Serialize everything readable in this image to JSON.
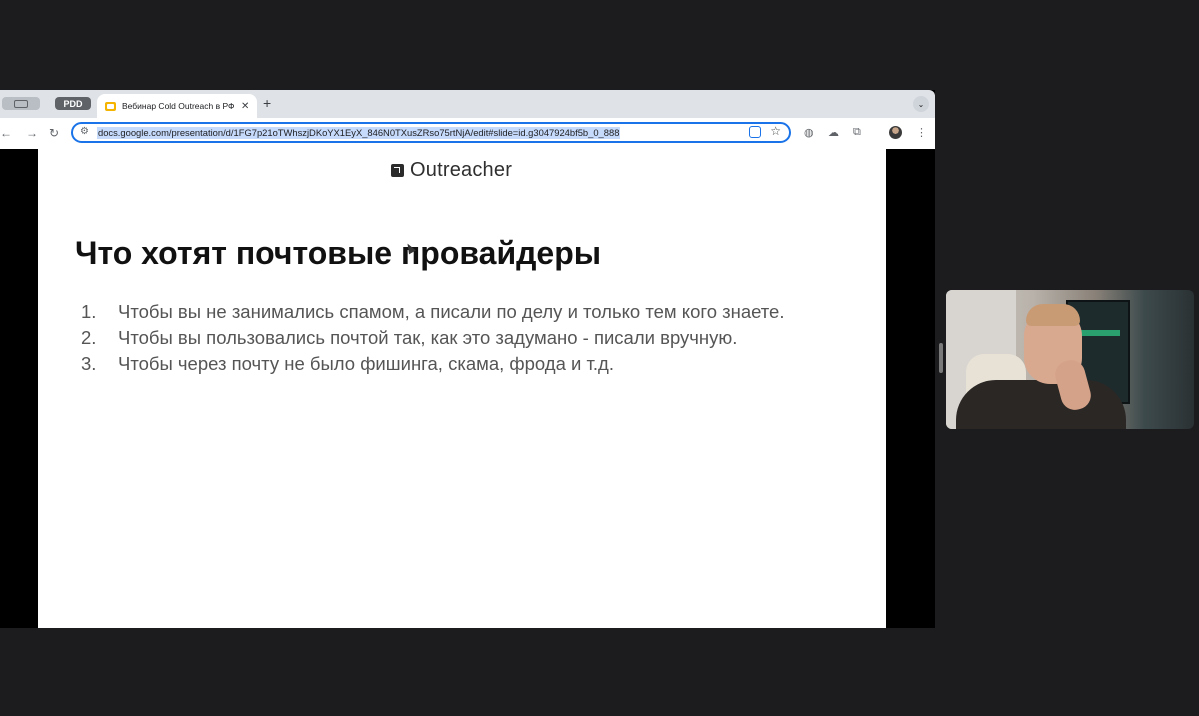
{
  "browser": {
    "tab_group_label": "PDD",
    "active_tab_title": "Вебинар Cold Outreach в РФ",
    "url": "docs.google.com/presentation/d/1FG7p21oTWhszjDKoYX1EyX_846N0TXusZRso75rtNjA/edit#slide=id.g3047924bf5b_0_888",
    "icons": {
      "back": "arrow-left-icon",
      "forward": "arrow-right-icon",
      "reload": "reload-icon",
      "site_info": "tune-icon",
      "lens": "lens-icon",
      "bookmark": "star-icon",
      "extensions": "puzzle-icon",
      "menu": "kebab-icon"
    }
  },
  "slide": {
    "logo_text": "Outreacher",
    "title": "Что хотят почтовые провайдеры",
    "items": [
      {
        "num": "1.",
        "text": "Чтобы вы не занимались спамом, а писали по делу и только тем кого знаете."
      },
      {
        "num": "2.",
        "text": "Чтобы вы пользовались почтой так, как это задумано - писали вручную."
      },
      {
        "num": "3.",
        "text": "Чтобы через почту не было фишинга, скама, фрода и т.д."
      }
    ]
  },
  "colors": {
    "omnibox_focus": "#1a73e8",
    "url_selection": "#c6dafb",
    "tab_favicon": "#f4b400",
    "page_background": "#1c1c1e"
  }
}
